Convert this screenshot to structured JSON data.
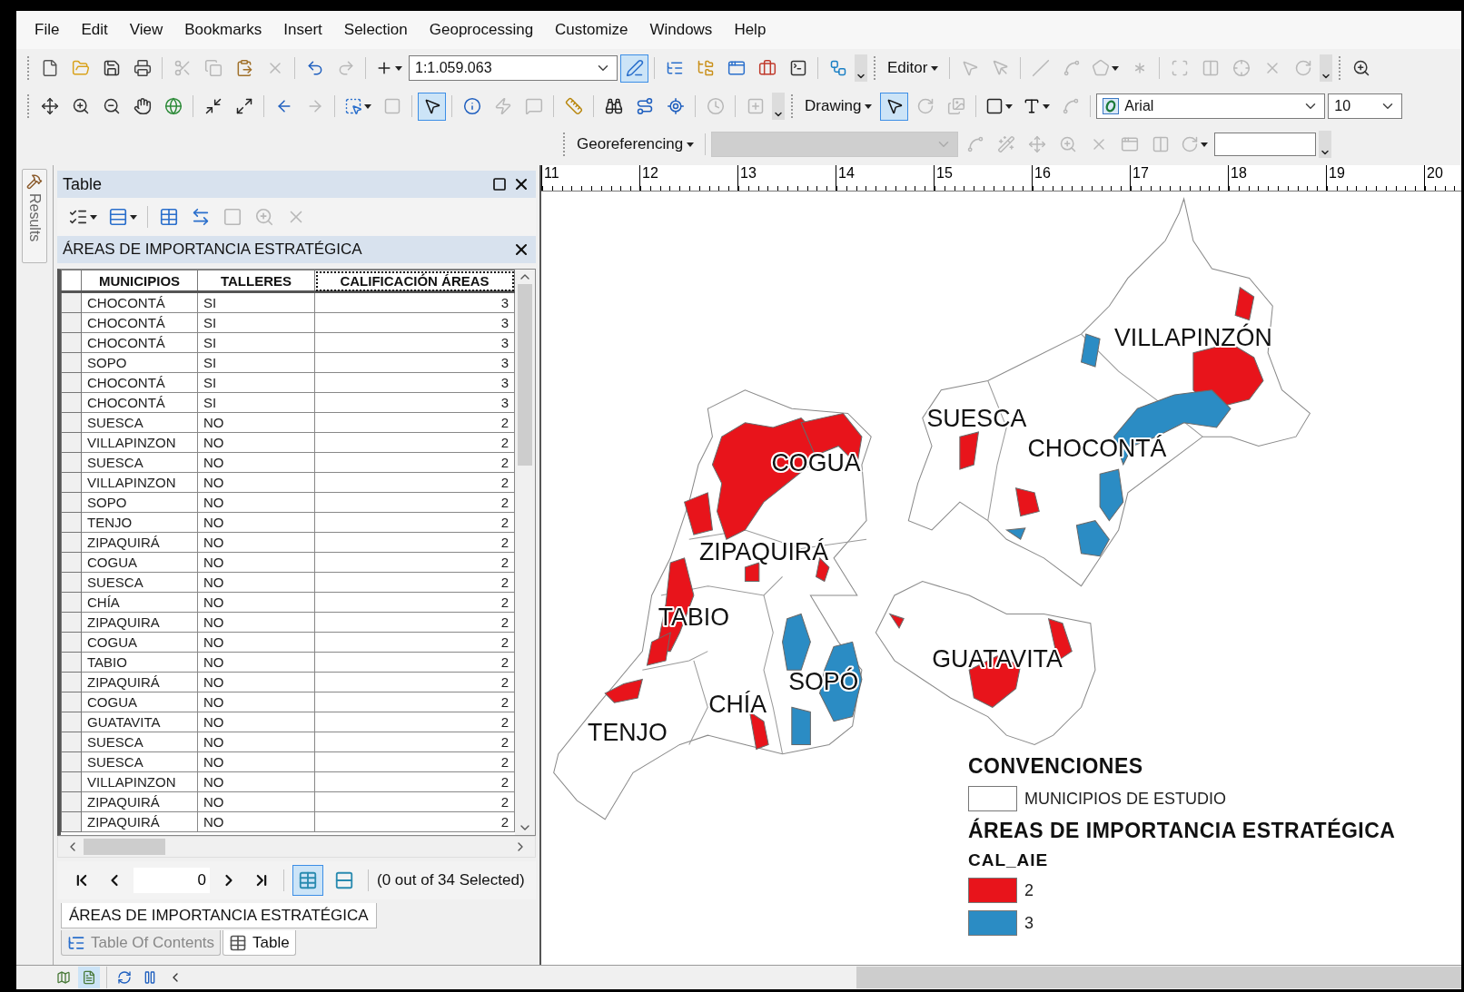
{
  "menu": [
    "File",
    "Edit",
    "View",
    "Bookmarks",
    "Insert",
    "Selection",
    "Geoprocessing",
    "Customize",
    "Windows",
    "Help"
  ],
  "toolbars": [
    {
      "items": [
        {
          "kind": "grip"
        },
        {
          "kind": "tool",
          "disabled": false,
          "selected": false
        },
        {
          "kind": "tool",
          "disabled": false,
          "selected": false
        },
        {
          "kind": "tool",
          "disabled": false,
          "selected": false
        },
        {
          "kind": "tool",
          "disabled": false,
          "selected": false
        },
        {
          "kind": "sep"
        },
        {
          "kind": "tool",
          "disabled": true,
          "selected": false
        },
        {
          "kind": "tool",
          "disabled": true,
          "selected": false
        },
        {
          "kind": "tool",
          "disabled": false,
          "selected": false
        },
        {
          "kind": "tool",
          "disabled": true,
          "selected": false
        },
        {
          "kind": "sep"
        },
        {
          "kind": "tool",
          "disabled": false,
          "selected": false
        },
        {
          "kind": "tool",
          "disabled": true,
          "selected": false
        },
        {
          "kind": "sep"
        },
        {
          "kind": "split",
          "disabled": false,
          "selected": false
        },
        {
          "kind": "combo",
          "value": "1:1.059.063",
          "disabled": false
        },
        {
          "kind": "tool",
          "disabled": false,
          "selected": true
        },
        {
          "kind": "sep"
        },
        {
          "kind": "tool",
          "disabled": false,
          "selected": false
        },
        {
          "kind": "tool",
          "disabled": false,
          "selected": false
        },
        {
          "kind": "tool",
          "disabled": false,
          "selected": false
        },
        {
          "kind": "tool",
          "disabled": false,
          "selected": false
        },
        {
          "kind": "tool",
          "disabled": false,
          "selected": false
        },
        {
          "kind": "sep"
        },
        {
          "kind": "tool",
          "disabled": false,
          "selected": false
        },
        {
          "kind": "overflow"
        },
        {
          "kind": "grip"
        },
        {
          "kind": "menu",
          "label": "Editor"
        },
        {
          "kind": "sep"
        },
        {
          "kind": "tool",
          "disabled": true,
          "selected": false
        },
        {
          "kind": "tool",
          "disabled": true,
          "selected": false
        },
        {
          "kind": "sep"
        },
        {
          "kind": "tool",
          "disabled": true,
          "selected": false
        },
        {
          "kind": "tool",
          "disabled": true,
          "selected": false
        },
        {
          "kind": "split",
          "disabled": true,
          "selected": false
        },
        {
          "kind": "tool",
          "disabled": true,
          "selected": false
        },
        {
          "kind": "sep"
        },
        {
          "kind": "tool",
          "disabled": true,
          "selected": false
        },
        {
          "kind": "tool",
          "disabled": true,
          "selected": false
        },
        {
          "kind": "tool",
          "disabled": true,
          "selected": false
        },
        {
          "kind": "tool",
          "disabled": true,
          "selected": false
        },
        {
          "kind": "tool",
          "disabled": true,
          "selected": false
        },
        {
          "kind": "overflow"
        },
        {
          "kind": "grip"
        },
        {
          "kind": "tool",
          "disabled": false,
          "selected": false
        }
      ]
    },
    {
      "items": [
        {
          "kind": "grip"
        },
        {
          "kind": "tool",
          "disabled": false,
          "selected": false
        },
        {
          "kind": "tool",
          "disabled": false,
          "selected": false
        },
        {
          "kind": "tool",
          "disabled": false,
          "selected": false
        },
        {
          "kind": "tool",
          "disabled": false,
          "selected": false
        },
        {
          "kind": "tool",
          "disabled": false,
          "selected": false
        },
        {
          "kind": "sep"
        },
        {
          "kind": "tool",
          "disabled": false,
          "selected": false
        },
        {
          "kind": "tool",
          "disabled": false,
          "selected": false
        },
        {
          "kind": "sep"
        },
        {
          "kind": "tool",
          "disabled": false,
          "selected": false
        },
        {
          "kind": "tool",
          "disabled": true,
          "selected": false
        },
        {
          "kind": "sep"
        },
        {
          "kind": "split",
          "disabled": false,
          "selected": false
        },
        {
          "kind": "tool",
          "disabled": true,
          "selected": false
        },
        {
          "kind": "sep"
        },
        {
          "kind": "tool",
          "disabled": false,
          "selected": true
        },
        {
          "kind": "sep"
        },
        {
          "kind": "tool",
          "disabled": false,
          "selected": false
        },
        {
          "kind": "tool",
          "disabled": true,
          "selected": false
        },
        {
          "kind": "tool",
          "disabled": true,
          "selected": false
        },
        {
          "kind": "sep"
        },
        {
          "kind": "tool",
          "disabled": false,
          "selected": false
        },
        {
          "kind": "sep"
        },
        {
          "kind": "tool",
          "disabled": false,
          "selected": false
        },
        {
          "kind": "tool",
          "disabled": false,
          "selected": false
        },
        {
          "kind": "tool",
          "disabled": false,
          "selected": false
        },
        {
          "kind": "sep"
        },
        {
          "kind": "tool",
          "disabled": true,
          "selected": false
        },
        {
          "kind": "sep"
        },
        {
          "kind": "tool",
          "disabled": true,
          "selected": false
        },
        {
          "kind": "overflow"
        },
        {
          "kind": "grip"
        },
        {
          "kind": "menu",
          "label": "Drawing"
        },
        {
          "kind": "tool",
          "disabled": false,
          "selected": true
        },
        {
          "kind": "tool",
          "disabled": true,
          "selected": false
        },
        {
          "kind": "tool",
          "disabled": true,
          "selected": false
        },
        {
          "kind": "sep"
        },
        {
          "kind": "split",
          "disabled": false,
          "selected": false
        },
        {
          "kind": "split",
          "disabled": false,
          "selected": false
        },
        {
          "kind": "tool",
          "disabled": true,
          "selected": false
        },
        {
          "kind": "sep"
        },
        {
          "kind": "combo",
          "value": "Arial",
          "disabled": false
        },
        {
          "kind": "combo",
          "value": "10",
          "disabled": false
        }
      ]
    },
    {
      "items": [
        {
          "kind": "grip"
        },
        {
          "kind": "menu",
          "label": "Georeferencing"
        },
        {
          "kind": "sep"
        },
        {
          "kind": "combo",
          "disabled": true
        },
        {
          "kind": "tool",
          "disabled": true,
          "selected": false
        },
        {
          "kind": "tool",
          "disabled": true,
          "selected": false
        },
        {
          "kind": "tool",
          "disabled": true,
          "selected": false
        },
        {
          "kind": "tool",
          "disabled": true,
          "selected": false
        },
        {
          "kind": "tool",
          "disabled": true,
          "selected": false
        },
        {
          "kind": "tool",
          "disabled": true,
          "selected": false
        },
        {
          "kind": "tool",
          "disabled": true,
          "selected": false
        },
        {
          "kind": "split",
          "disabled": true,
          "selected": false
        },
        {
          "kind": "field"
        },
        {
          "kind": "overflow"
        }
      ]
    }
  ],
  "side_tabs": [
    {
      "label": "Results"
    }
  ],
  "table_window": {
    "title": "Table",
    "tools": [
      {
        "kind": "split",
        "disabled": false
      },
      {
        "kind": "split",
        "disabled": false
      },
      {
        "kind": "sep"
      },
      {
        "kind": "tool",
        "disabled": false
      },
      {
        "kind": "tool",
        "disabled": false
      },
      {
        "kind": "tool",
        "disabled": true
      },
      {
        "kind": "tool",
        "disabled": true
      },
      {
        "kind": "tool",
        "disabled": true
      }
    ],
    "layer": "ÁREAS DE IMPORTANCIA ESTRATÉGICA",
    "columns": [
      {
        "label": "MUNICIPIOS",
        "kind": "text",
        "selected": false
      },
      {
        "label": "TALLERES",
        "kind": "text",
        "selected": false
      },
      {
        "label": "CALIFICACIÓN ÁREAS",
        "kind": "number",
        "selected": true
      }
    ],
    "rows": [
      {
        "selected": false,
        "cells": [
          "CHOCONTÁ",
          "SI",
          "3"
        ]
      },
      {
        "selected": false,
        "cells": [
          "CHOCONTÁ",
          "SI",
          "3"
        ]
      },
      {
        "selected": false,
        "cells": [
          "CHOCONTÁ",
          "SI",
          "3"
        ]
      },
      {
        "selected": false,
        "cells": [
          "SOPO",
          "SI",
          "3"
        ]
      },
      {
        "selected": false,
        "cells": [
          "CHOCONTÁ",
          "SI",
          "3"
        ]
      },
      {
        "selected": false,
        "cells": [
          "CHOCONTÁ",
          "SI",
          "3"
        ]
      },
      {
        "selected": false,
        "cells": [
          "SUESCA",
          "NO",
          "2"
        ]
      },
      {
        "selected": false,
        "cells": [
          "VILLAPINZON",
          "NO",
          "2"
        ]
      },
      {
        "selected": false,
        "cells": [
          "SUESCA",
          "NO",
          "2"
        ]
      },
      {
        "selected": false,
        "cells": [
          "VILLAPINZON",
          "NO",
          "2"
        ]
      },
      {
        "selected": false,
        "cells": [
          "SOPO",
          "NO",
          "2"
        ]
      },
      {
        "selected": false,
        "cells": [
          "TENJO",
          "NO",
          "2"
        ]
      },
      {
        "selected": false,
        "cells": [
          "ZIPAQUIRÁ",
          "NO",
          "2"
        ]
      },
      {
        "selected": false,
        "cells": [
          "COGUA",
          "NO",
          "2"
        ]
      },
      {
        "selected": false,
        "cells": [
          "SUESCA",
          "NO",
          "2"
        ]
      },
      {
        "selected": false,
        "cells": [
          "CHÍA",
          "NO",
          "2"
        ]
      },
      {
        "selected": false,
        "cells": [
          "ZIPAQUIRA",
          "NO",
          "2"
        ]
      },
      {
        "selected": false,
        "cells": [
          "COGUA",
          "NO",
          "2"
        ]
      },
      {
        "selected": false,
        "cells": [
          "TABIO",
          "NO",
          "2"
        ]
      },
      {
        "selected": false,
        "cells": [
          "ZIPAQUIRÁ",
          "NO",
          "2"
        ]
      },
      {
        "selected": false,
        "cells": [
          "COGUA",
          "NO",
          "2"
        ]
      },
      {
        "selected": false,
        "cells": [
          "GUATAVITA",
          "NO",
          "2"
        ]
      },
      {
        "selected": false,
        "cells": [
          "SUESCA",
          "NO",
          "2"
        ]
      },
      {
        "selected": false,
        "cells": [
          "SUESCA",
          "NO",
          "2"
        ]
      },
      {
        "selected": false,
        "cells": [
          "VILLAPINZON",
          "NO",
          "2"
        ]
      },
      {
        "selected": false,
        "cells": [
          "ZIPAQUIRÁ",
          "NO",
          "2"
        ]
      },
      {
        "selected": false,
        "cells": [
          "ZIPAQUIRÁ",
          "NO",
          "2"
        ]
      }
    ],
    "record": "0",
    "view_buttons": [
      {
        "selected": true
      },
      {
        "selected": false
      }
    ],
    "selection_status": "(0 out of 34 Selected)",
    "layer_tabs": [
      {
        "label": "ÁREAS DE IMPORTANCIA ESTRATÉGICA",
        "selected": true
      }
    ]
  },
  "dock_tabs": [
    {
      "label": "Table Of Contents",
      "selected": false
    },
    {
      "label": "Table",
      "selected": true
    }
  ],
  "map": {
    "ruler": [
      "11",
      "12",
      "13",
      "14",
      "15",
      "16",
      "17",
      "18",
      "19",
      "20"
    ],
    "labels": [
      "VILLAPINZÓN",
      "SUESCA",
      "CHOCONTÁ",
      "COGUA",
      "ZIPAQUIRÁ",
      "TABIO",
      "GUATAVITA",
      "SOPÓ",
      "CHÍA",
      "TENJO"
    ],
    "legend": {
      "title": "CONVENCIONES",
      "items": [
        {
          "label": "MUNICIPIOS DE ESTUDIO",
          "color": "#ffffff"
        }
      ],
      "layer": "ÁREAS DE IMPORTANCIA ESTRATÉGICA",
      "field": "CAL_AIE",
      "classes": [
        {
          "label": "2",
          "color": "#e8141b"
        },
        {
          "label": "3",
          "color": "#2b8cc4"
        }
      ]
    }
  },
  "status_bar": {
    "view_buttons": [
      {
        "selected": false
      },
      {
        "selected": true
      }
    ]
  }
}
